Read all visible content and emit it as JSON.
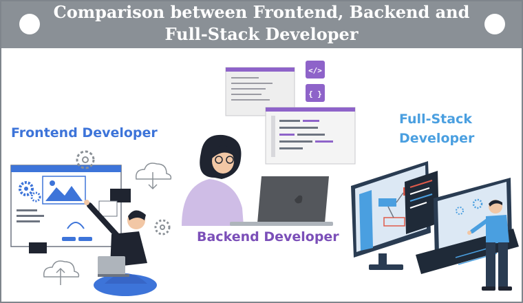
{
  "header": {
    "title_line1": "Comparison between Frontend, Backend and",
    "title_line2": "Full-Stack Developer"
  },
  "roles": {
    "frontend": "Frontend Developer",
    "backend": "Backend Developer",
    "fullstack_line1": "Full-Stack",
    "fullstack_line2": "Developer"
  },
  "backend_icons": {
    "code_tag": "</>",
    "braces": "{ }"
  },
  "colors": {
    "banner": "#8a9096",
    "frontend_label": "#3d74d9",
    "backend_label": "#7b4fb8",
    "fullstack_label": "#4a9fe0"
  },
  "icons": [
    "gear-icon",
    "cloud-download-icon",
    "cloud-upload-icon",
    "code-tag-icon",
    "braces-icon",
    "laptop-icon"
  ]
}
